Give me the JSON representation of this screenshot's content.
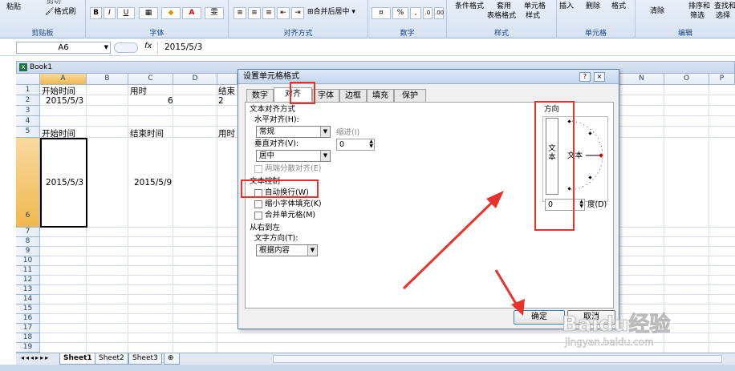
{
  "ribbon": {
    "clipboard": {
      "paste": "粘贴",
      "cut": "剪切",
      "format_painter": "格式刷",
      "label": "剪贴板"
    },
    "font": {
      "bold": "B",
      "italic": "I",
      "underline": "U",
      "font_color": "A",
      "wen": "雯",
      "label": "字体"
    },
    "alignment": {
      "merge_center": "合并后居中",
      "label": "对齐方式"
    },
    "number": {
      "percent": "%",
      "comma": ",",
      "label": "数字"
    },
    "styles": {
      "conditional": "条件格式",
      "table_format": "套用",
      "table_format2": "表格格式",
      "cell_styles": "单元格",
      "cell_styles2": "样式",
      "label": "样式"
    },
    "cells": {
      "insert": "插入",
      "delete": "删除",
      "format": "格式",
      "label": "单元格"
    },
    "editing": {
      "clear": "清除",
      "sort": "排序和",
      "filter": "筛选",
      "find": "查找和",
      "select": "选择",
      "label": "编辑"
    }
  },
  "formula_bar": {
    "name_box": "A6",
    "fx": "fx",
    "value": "2015/5/3"
  },
  "workbook": {
    "title": "Book1"
  },
  "sheet": {
    "columns": [
      "A",
      "B",
      "C",
      "D",
      "N",
      "O",
      "P"
    ],
    "rows": [
      "1",
      "2",
      "3",
      "4",
      "5",
      "6",
      "7",
      "8",
      "9",
      "10",
      "11",
      "12",
      "13",
      "14",
      "15",
      "16",
      "17",
      "18",
      "19"
    ],
    "cells": {
      "a1": "开始时间",
      "c1": "用时",
      "e1": "结束",
      "a2": "2015/5/3",
      "c2": "6",
      "e2": "2",
      "a5": "开始时间",
      "c5": "结束时间",
      "e5": "用时",
      "a6": "2015/5/3",
      "c6": "2015/5/9"
    },
    "tabs": [
      "Sheet1",
      "Sheet2",
      "Sheet3"
    ]
  },
  "dialog": {
    "title": "设置单元格格式",
    "help": "?",
    "close": "×",
    "tabs": [
      "数字",
      "对齐",
      "字体",
      "边框",
      "填充",
      "保护"
    ],
    "text_alignment": "文本对齐方式",
    "horizontal_label": "水平对齐(H):",
    "horizontal_value": "常规",
    "indent_label": "缩进(I)",
    "indent_value": "0",
    "vertical_label": "垂直对齐(V):",
    "vertical_value": "居中",
    "justify_distributed": "两端分散对齐(E)",
    "text_control": "文本控制",
    "wrap_text": "自动换行(W)",
    "shrink_to_fit": "缩小字体填充(K)",
    "merge_cells": "合并单元格(M)",
    "rtl": "从右到左",
    "text_direction_label": "文字方向(T):",
    "text_direction_value": "根据内容",
    "orientation": "方向",
    "vertical_text": "文本",
    "orientation_text": "文本",
    "degree_value": "0",
    "degree_label": "度(D)",
    "ok": "确定",
    "cancel": "取消"
  },
  "watermark": {
    "brand": "Baidu经验",
    "url": "jingyan.baidu.com"
  }
}
